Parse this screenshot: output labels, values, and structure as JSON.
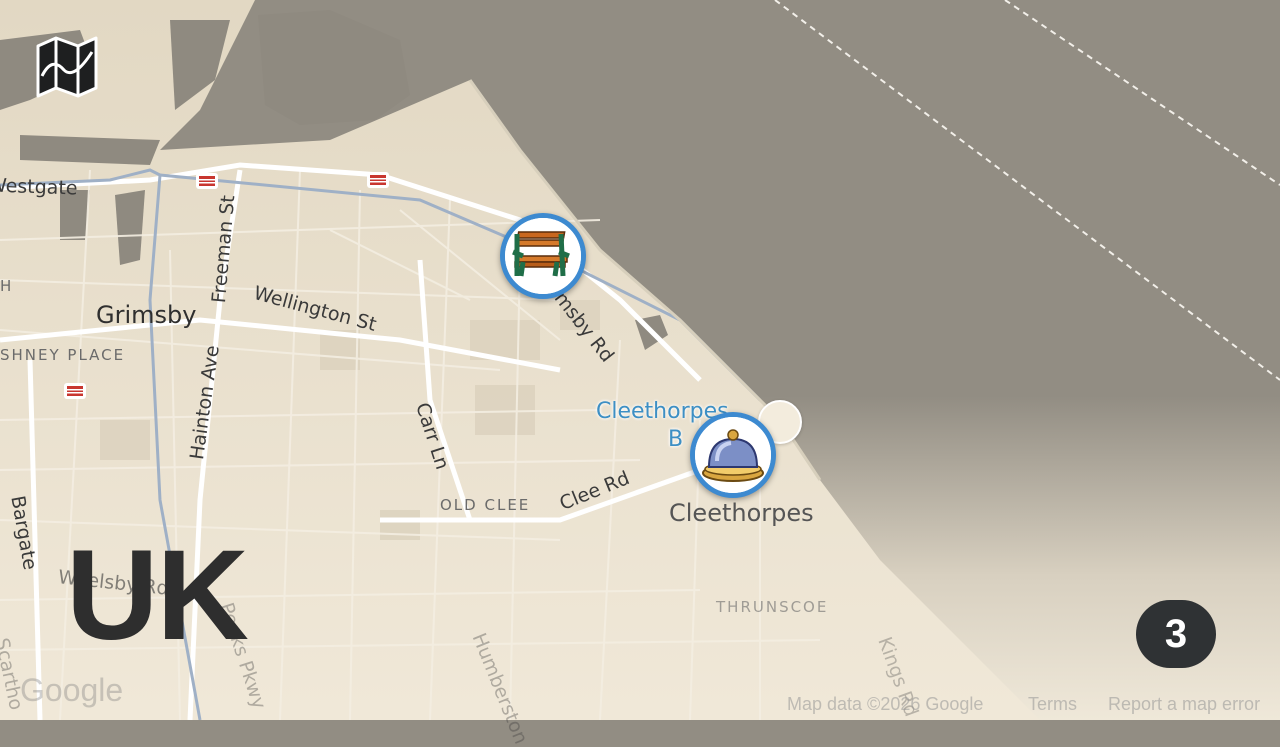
{
  "map": {
    "region_label": "UK",
    "round_number": "3",
    "street_labels": {
      "westgate": "Westgate",
      "freeman_st": "Freeman St",
      "wellington_st": "Wellington St",
      "grimsby_rd": "Grimsby Rd",
      "hainton_ave": "Hainton Ave",
      "carr_ln": "Carr Ln",
      "clee_rd": "Clee Rd",
      "bargate": "Bargate",
      "welsby_rd": "Weelsby Rd",
      "peaks_pkwy": "Peaks Pkwy",
      "humberston": "Humberston",
      "kings_rd": "Kings Rd",
      "scartho": "Scartho"
    },
    "towns": {
      "grimsby": "Grimsby",
      "cleethorpes": "Cleethorpes"
    },
    "districts": {
      "freshney_place": "SHNEY PLACE",
      "old_clee": "OLD CLEE",
      "thrunscoe": "THRUNSCOE",
      "edge_label": "H"
    },
    "poi": {
      "beach_line1": "Cleethorpes",
      "beach_line2": "B"
    },
    "markers": [
      {
        "name": "bench",
        "icon": "bench-icon"
      },
      {
        "name": "service-bell",
        "icon": "service-bell-icon"
      }
    ],
    "attribution": {
      "google": "Google",
      "map_data": "Map data ©2026 Google",
      "terms": "Terms",
      "report": "Report a map error"
    },
    "colors": {
      "land": "#e9e0cc",
      "sea": "#928d83",
      "marker_ring": "#3d8ad0",
      "badge": "#2f3234"
    }
  }
}
